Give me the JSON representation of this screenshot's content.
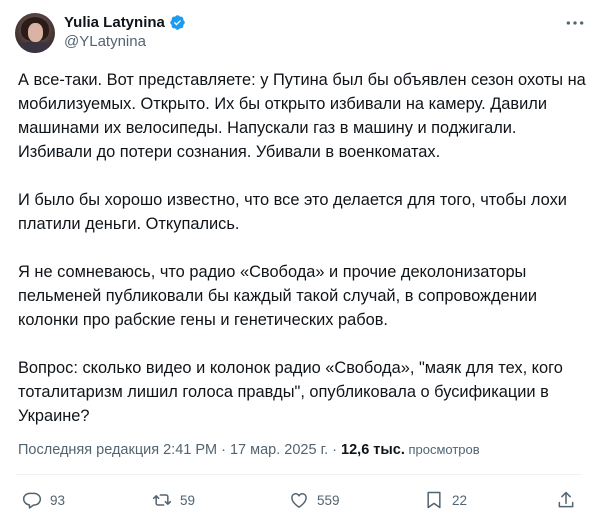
{
  "author": {
    "display_name": "Yulia Latynina",
    "handle": "@YLatynina"
  },
  "tweet": {
    "paragraphs": [
      "А все-таки. Вот представляете: у Путина был бы объявлен сезон охоты на мобилизуемых. Открыто. Их бы открыто избивали на камеру. Давили машинами их велосипеды. Напускали газ в машину и поджигали. Избивали до потери сознания. Убивали в военкоматах.",
      "И было бы хорошо известно, что все это делается для того, чтобы лохи платили деньги. Откупались.",
      "Я не сомневаюсь, что радио «Свобода» и прочие деколонизаторы пельменей публиковали бы каждый такой случай, в сопровождении колонки про рабские гены и генетических рабов.",
      "Вопрос: сколько видео и колонок радио «Свобода», \"маяк для тех, кого тоталитаризм лишил голоса правды\", опубликовала о бусификации в Украине?"
    ]
  },
  "meta": {
    "edit_label": "Последняя редакция 2:41 PM · 17 мар. 2025 г. · ",
    "views_count": "12,6 тыс.",
    "views_label": " просмотров"
  },
  "actions": {
    "replies": "93",
    "reposts": "59",
    "likes": "559",
    "bookmarks": "22"
  },
  "colors": {
    "verified": "#1d9bf0",
    "secondary_text": "#536471",
    "primary_text": "#0f1419"
  },
  "icons": [
    "verified-badge-icon",
    "more-icon",
    "reply-icon",
    "repost-icon",
    "like-icon",
    "bookmark-icon",
    "share-icon"
  ]
}
